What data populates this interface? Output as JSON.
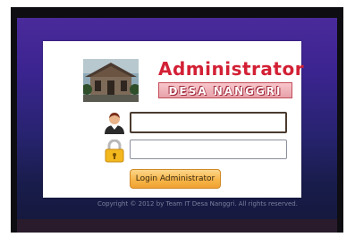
{
  "header": {
    "title": "Administrator",
    "subtitle": "DESA NANGGRI"
  },
  "form": {
    "username_icon": "user-avatar-icon",
    "password_icon": "lock-icon",
    "username_value": "",
    "password_value": "",
    "login_label": "Login Administrator"
  },
  "footer": {
    "copyright": "Copyright © 2012 by Team IT Desa Nanggri. All rights reserved."
  },
  "colors": {
    "title": "#d32035",
    "button": "#f7b549",
    "background_top": "#4a2a9a",
    "background_bottom": "#14183a"
  }
}
